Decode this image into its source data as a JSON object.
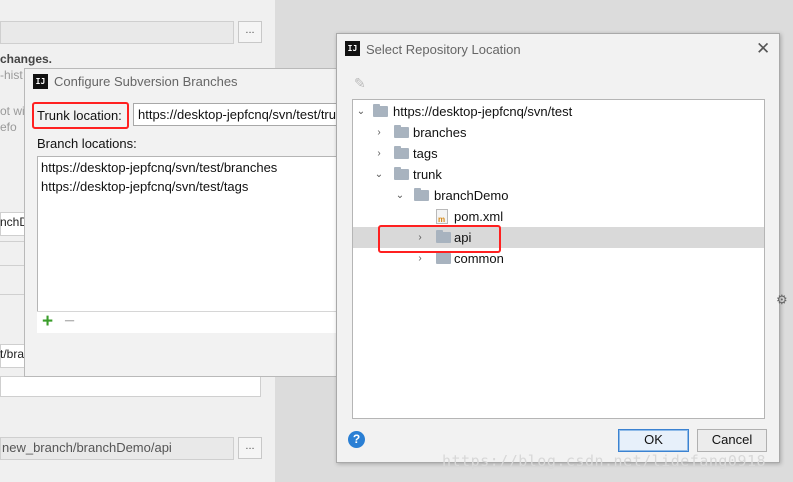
{
  "background": {
    "changes_text": "changes.",
    "hist_text": "-hist",
    "frag1": "ot wi",
    "frag2": "efo",
    "frag3": "nchD",
    "path_frag": "t/bra",
    "bottom_path": "new_branch/branchDemo/api",
    "browse_button": "..."
  },
  "configure_dialog": {
    "title": "Configure Subversion Branches",
    "trunk_label": "Trunk location:",
    "trunk_value": "https://desktop-jepfcnq/svn/test/trunk",
    "branch_label": "Branch locations:",
    "branches": [
      "https://desktop-jepfcnq/svn/test/branches",
      "https://desktop-jepfcnq/svn/test/tags"
    ],
    "add_symbol": "+",
    "remove_symbol": "−"
  },
  "select_dialog": {
    "title": "Select Repository Location",
    "close_symbol": "✕",
    "tree": [
      {
        "label": "https://desktop-jepfcnq/svn/test",
        "arrow": "⌄",
        "icon": "folder"
      },
      {
        "label": "branches",
        "arrow": "›",
        "icon": "folder"
      },
      {
        "label": "tags",
        "arrow": "›",
        "icon": "folder"
      },
      {
        "label": "trunk",
        "arrow": "⌄",
        "icon": "folder"
      },
      {
        "label": "branchDemo",
        "arrow": "⌄",
        "icon": "folder"
      },
      {
        "label": "pom.xml",
        "arrow": "",
        "icon": "maven-file"
      },
      {
        "label": "api",
        "arrow": "›",
        "icon": "folder",
        "selected": true
      },
      {
        "label": "common",
        "arrow": "›",
        "icon": "folder"
      }
    ],
    "help_symbol": "?",
    "ok_label": "OK",
    "cancel_label": "Cancel"
  },
  "watermark": "https://blog.csdn.net/lidefang0918"
}
